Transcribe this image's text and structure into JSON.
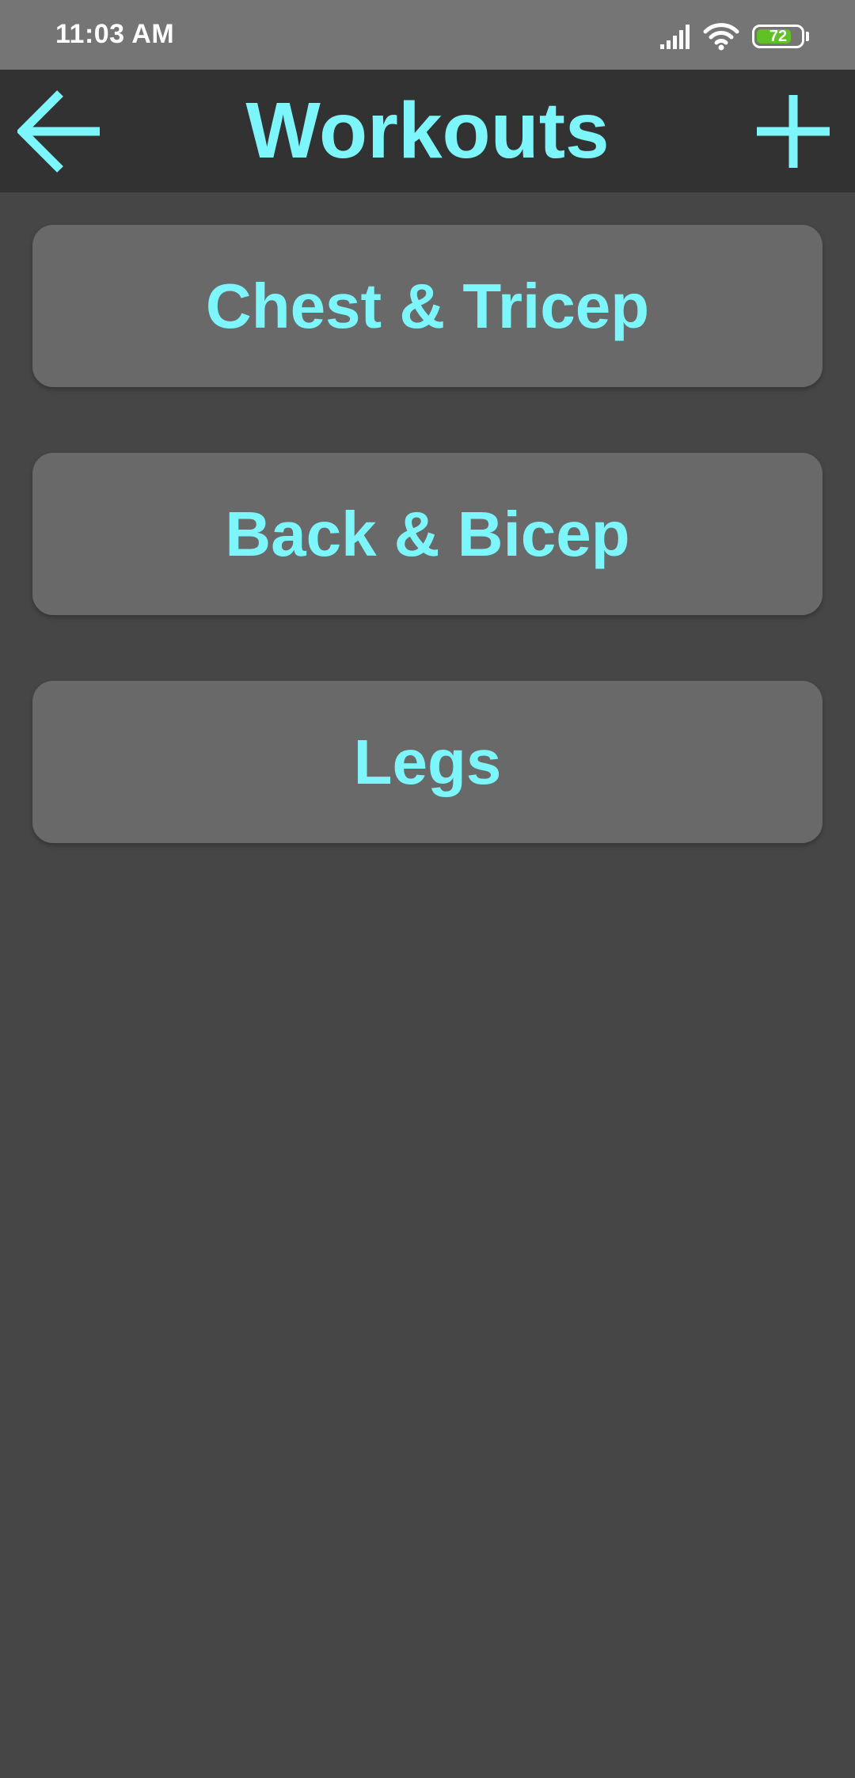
{
  "status_bar": {
    "time": "11:03 AM",
    "battery_level": "72"
  },
  "app_bar": {
    "title": "Workouts",
    "back_icon": "arrow-left-icon",
    "add_icon": "plus-icon"
  },
  "workouts": [
    {
      "label": "Chest & Tricep"
    },
    {
      "label": "Back & Bicep"
    },
    {
      "label": "Legs"
    }
  ],
  "colors": {
    "accent": "#7df6fb",
    "background": "#464646",
    "app_bar": "#323232",
    "status_bar": "#757575",
    "card": "#696969",
    "battery": "#5fc123"
  }
}
